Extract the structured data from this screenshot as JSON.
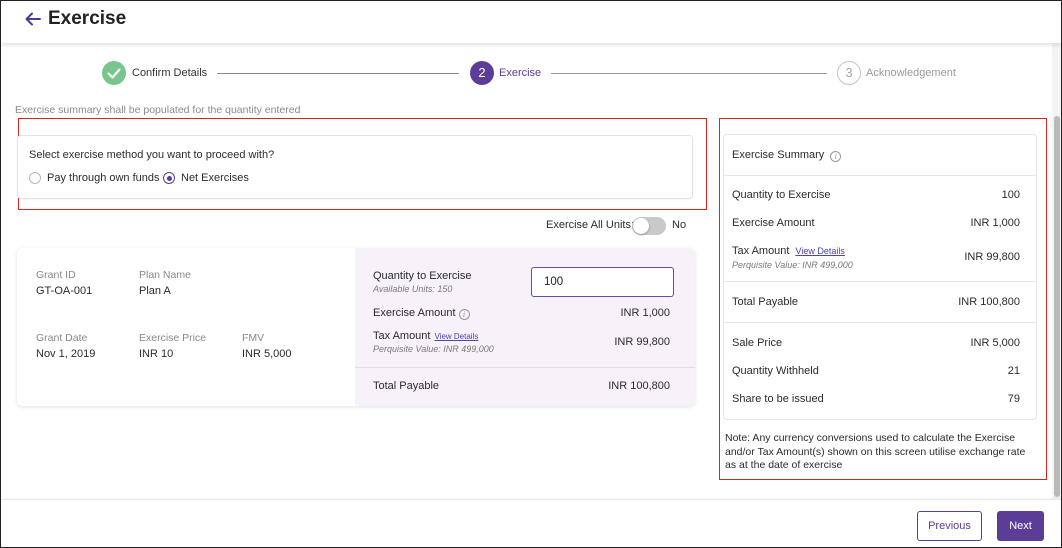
{
  "header": {
    "title": "Exercise"
  },
  "stepper": {
    "steps": [
      {
        "label": "Confirm Details",
        "state": "done"
      },
      {
        "number": "2",
        "label": "Exercise",
        "state": "active"
      },
      {
        "number": "3",
        "label": "Acknowledgement",
        "state": "pending"
      }
    ]
  },
  "hint": "Exercise summary shall be populated for the quantity entered",
  "method": {
    "question": "Select exercise method you want to proceed with?",
    "options": [
      {
        "label": "Pay through own funds",
        "selected": false
      },
      {
        "label": "Net Exercises",
        "selected": true
      }
    ]
  },
  "exercise_all": {
    "label": "Exercise All Units:",
    "value": "No",
    "on": false
  },
  "grant": {
    "grant_id_label": "Grant ID",
    "grant_id": "GT-OA-001",
    "plan_name_label": "Plan Name",
    "plan_name": "Plan A",
    "grant_date_label": "Grant Date",
    "grant_date": "Nov 1, 2019",
    "exercise_price_label": "Exercise Price",
    "exercise_price": "INR  10",
    "fmv_label": "FMV",
    "fmv": "INR  5,000"
  },
  "calc": {
    "qty_label": "Quantity to Exercise",
    "available": "Available Units: 150",
    "qty_value": "100",
    "amount_label": "Exercise Amount",
    "amount_value": "INR  1,000",
    "tax_label": "Tax Amount",
    "view_details": "View Details",
    "perquisite": "Perquisite Value:  INR  499,000",
    "tax_value": "INR  99,800",
    "total_label": "Total Payable",
    "total_value": "INR  100,800"
  },
  "summary": {
    "title": "Exercise Summary",
    "qty_label": "Quantity to Exercise",
    "qty_value": "100",
    "amount_label": "Exercise Amount",
    "amount_value": "INR 1,000",
    "tax_label": "Tax Amount",
    "view_details": "View Details",
    "perquisite": "Perquisite Value:  INR  499,000",
    "tax_value": "INR 99,800",
    "total_label": "Total Payable",
    "total_value": "INR 100,800",
    "sale_label": "Sale Price",
    "sale_value": "INR 5,000",
    "withheld_label": "Quantity Withheld",
    "withheld_value": "21",
    "issued_label": "Share to be issued",
    "issued_value": "79",
    "note": "Note: Any currency conversions used to calculate the Exercise and/or Tax Amount(s) shown on this screen utilise exchange rate as at the date of exercise"
  },
  "footer": {
    "previous": "Previous",
    "next": "Next"
  },
  "colors": {
    "accent": "#5b3d97",
    "success": "#78c58e",
    "highlight_border": "#dd2222"
  }
}
